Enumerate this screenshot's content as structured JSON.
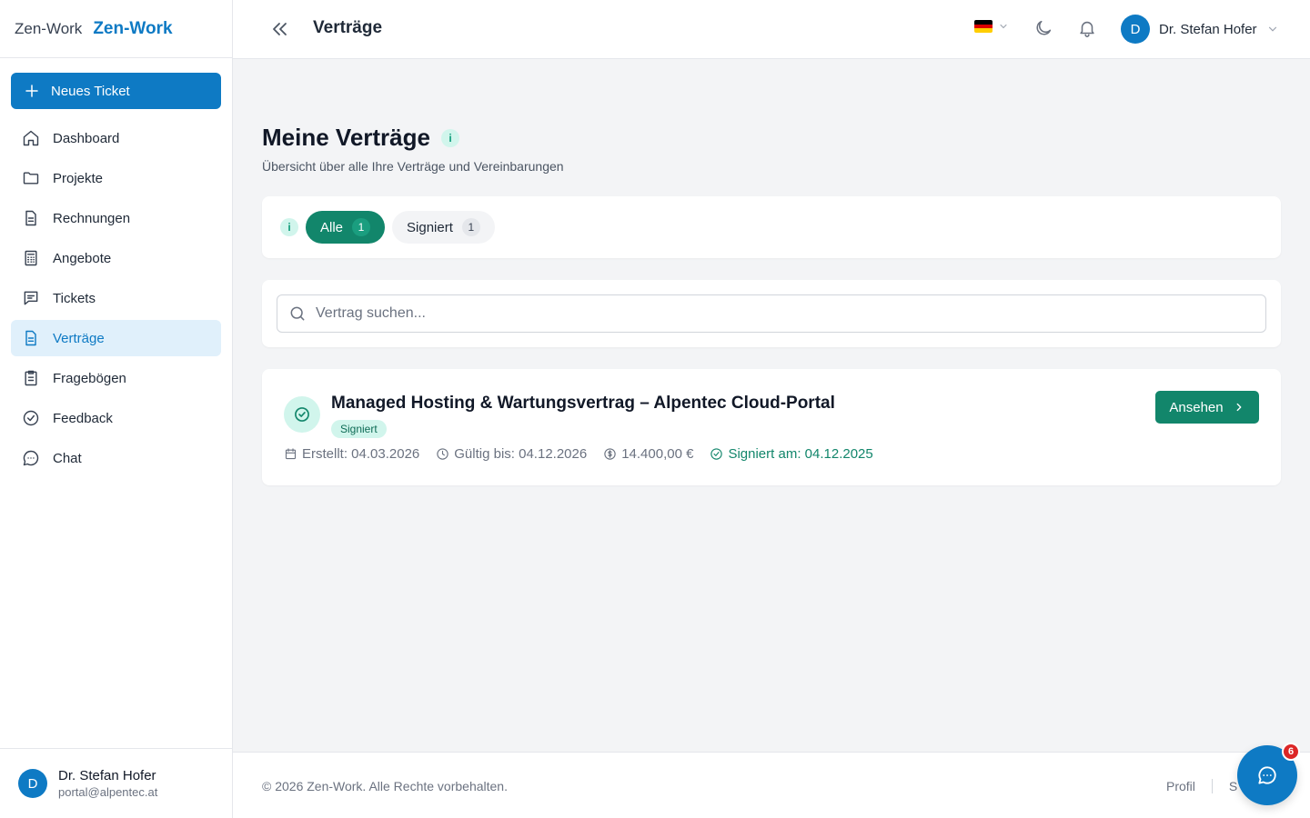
{
  "brand": {
    "logo_alt": "Zen-Work",
    "name": "Zen-Work"
  },
  "sidebar": {
    "new_ticket_label": "Neues Ticket",
    "items": [
      {
        "label": "Dashboard",
        "icon": "home-icon"
      },
      {
        "label": "Projekte",
        "icon": "folder-icon"
      },
      {
        "label": "Rechnungen",
        "icon": "file-text-icon"
      },
      {
        "label": "Angebote",
        "icon": "calculator-icon"
      },
      {
        "label": "Tickets",
        "icon": "message-square-icon"
      },
      {
        "label": "Verträge",
        "icon": "file-contract-icon",
        "active": true
      },
      {
        "label": "Fragebögen",
        "icon": "clipboard-icon"
      },
      {
        "label": "Feedback",
        "icon": "check-circle-icon"
      },
      {
        "label": "Chat",
        "icon": "message-circle-icon"
      }
    ],
    "user": {
      "initial": "D",
      "name": "Dr. Stefan Hofer",
      "email": "portal@alpentec.at"
    }
  },
  "header": {
    "title": "Verträge",
    "language": "de",
    "user": {
      "initial": "D",
      "name": "Dr. Stefan Hofer"
    }
  },
  "main": {
    "title": "Meine Verträge",
    "info_badge": "i",
    "subtitle": "Übersicht über alle Ihre Verträge und Vereinbarungen",
    "filters": {
      "info_badge": "i",
      "items": [
        {
          "label": "Alle",
          "count": "1",
          "active": true
        },
        {
          "label": "Signiert",
          "count": "1",
          "active": false
        }
      ]
    },
    "search": {
      "placeholder": "Vertrag suchen...",
      "value": ""
    },
    "contracts": [
      {
        "title": "Managed Hosting & Wartungsvertrag – Alpentec Cloud-Portal",
        "status": "Signiert",
        "created": "Erstellt: 04.03.2026",
        "valid_until": "Gültig bis: 04.12.2026",
        "amount": "14.400,00 €",
        "signed": "Signiert am: 04.12.2025",
        "action": "Ansehen"
      }
    ]
  },
  "footer": {
    "copyright": "© 2026 Zen-Work. Alle Rechte vorbehalten.",
    "links": [
      "Profil",
      "S"
    ]
  },
  "chat": {
    "unread": "6"
  },
  "colors": {
    "primary": "#0e7ac4",
    "success": "#12866b",
    "success_light": "#d1f5ec",
    "danger": "#dc2626"
  }
}
